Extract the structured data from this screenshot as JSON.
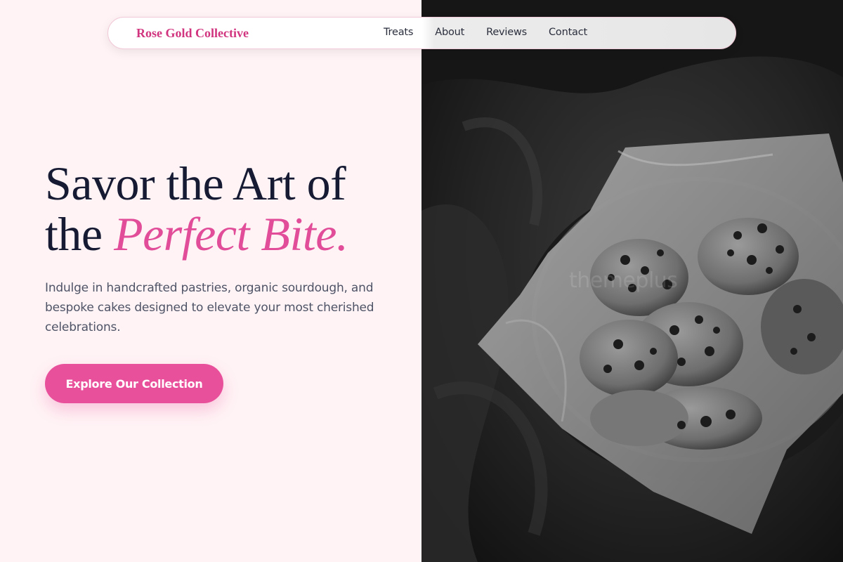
{
  "brand": {
    "name": "Rose Gold Collective"
  },
  "nav": {
    "items": [
      {
        "label": "Treats"
      },
      {
        "label": "About"
      },
      {
        "label": "Reviews"
      },
      {
        "label": "Contact"
      }
    ]
  },
  "hero": {
    "title_line1": "Savor the Art of",
    "title_line2_prefix": "the ",
    "title_accent": "Perfect Bite.",
    "subtitle": "Indulge in handcrafted pastries, organic sourdough, and bespoke cakes designed to elevate your most cherished celebrations.",
    "cta_label": "Explore Our Collection"
  },
  "image": {
    "subject": "black-and-white photo of chocolate chip cookies in a paper-lined bowl",
    "watermark": "themeplus"
  },
  "colors": {
    "accent": "#e8509b",
    "brand": "#d1357f",
    "background": "#fff3f5",
    "title": "#161b33"
  }
}
